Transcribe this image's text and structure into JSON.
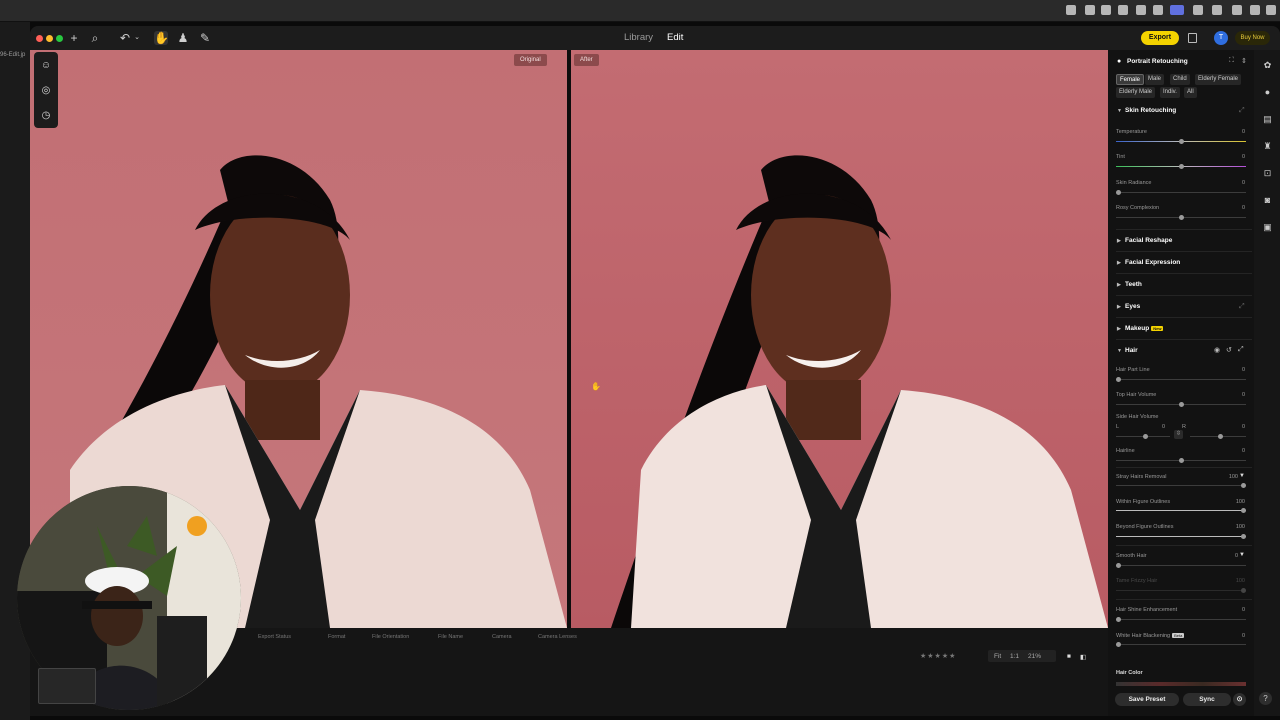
{
  "left_strip": {
    "file_name": "96-Edit.jp"
  },
  "titlebar": {
    "tab_library": "Library",
    "tab_edit": "Edit",
    "export_label": "Export",
    "avatar_initial": "T",
    "buy_label": "Buy Now"
  },
  "compare": {
    "left_label": "Original",
    "right_label": "After"
  },
  "bottombar": {
    "items": [
      "Export Status",
      "Format",
      "File Orientation",
      "File Name",
      "Camera",
      "Camera Lenses"
    ],
    "fit_label": "Fit",
    "ratio_label": "1:1",
    "zoom_label": "21%"
  },
  "right_panel": {
    "title": "Portrait Retouching",
    "chips": [
      "Female",
      "Male",
      "Child",
      "Elderly Female",
      "Elderly Male",
      "Indiv.",
      "All"
    ],
    "selected_chip": "Female",
    "sections": {
      "skin_retouching": "Skin Retouching",
      "facial_reshape": "Facial Reshape",
      "facial_expression": "Facial Expression",
      "teeth": "Teeth",
      "eyes": "Eyes",
      "makeup": "Makeup",
      "makeup_badge": "New",
      "hair": "Hair",
      "hair_color": "Hair Color"
    },
    "sliders": {
      "temperature": {
        "label": "Temperature",
        "value": "0",
        "level": 0.5
      },
      "tint": {
        "label": "Tint",
        "value": "0",
        "level": 0.5
      },
      "skin_radiance": {
        "label": "Skin Radiance",
        "value": "0",
        "level": 0
      },
      "rosy_complexion": {
        "label": "Rosy Complexion",
        "value": "0",
        "level": 0.5
      },
      "hair_part_line": {
        "label": "Hair Part Line",
        "value": "0",
        "level": 0
      },
      "top_hair_volume": {
        "label": "Top Hair Volume",
        "value": "0",
        "level": 0.5
      },
      "side_hair_volume": {
        "label": "Side Hair Volume",
        "l_label": "L",
        "l_value": "0",
        "r_label": "R",
        "r_value": "0"
      },
      "hairline": {
        "label": "Hairline",
        "value": "0",
        "level": 0.5
      },
      "stray_hairs_removal": {
        "label": "Stray Hairs Removal",
        "value": "100",
        "level": 1
      },
      "within_figure_outlines": {
        "label": "Within Figure Outlines",
        "value": "100",
        "level": 1
      },
      "beyond_figure_outlines": {
        "label": "Beyond Figure Outlines",
        "value": "100",
        "level": 1
      },
      "smooth_hair": {
        "label": "Smooth Hair",
        "value": "0",
        "level": 0
      },
      "tame_frizzy_hair": {
        "label": "Tame Frizzy Hair",
        "value": "100",
        "level": 1
      },
      "hair_shine_enhancement": {
        "label": "Hair Shine Enhancement",
        "value": "0",
        "level": 0
      },
      "white_hair_blackening": {
        "label": "White Hair Blackening",
        "value": "0",
        "level": 0,
        "badge": "Beta"
      }
    },
    "footer": {
      "save_preset": "Save Preset",
      "sync": "Sync"
    }
  },
  "colors": {
    "accent": "#f4d300",
    "background_pink": "#c26f74"
  }
}
